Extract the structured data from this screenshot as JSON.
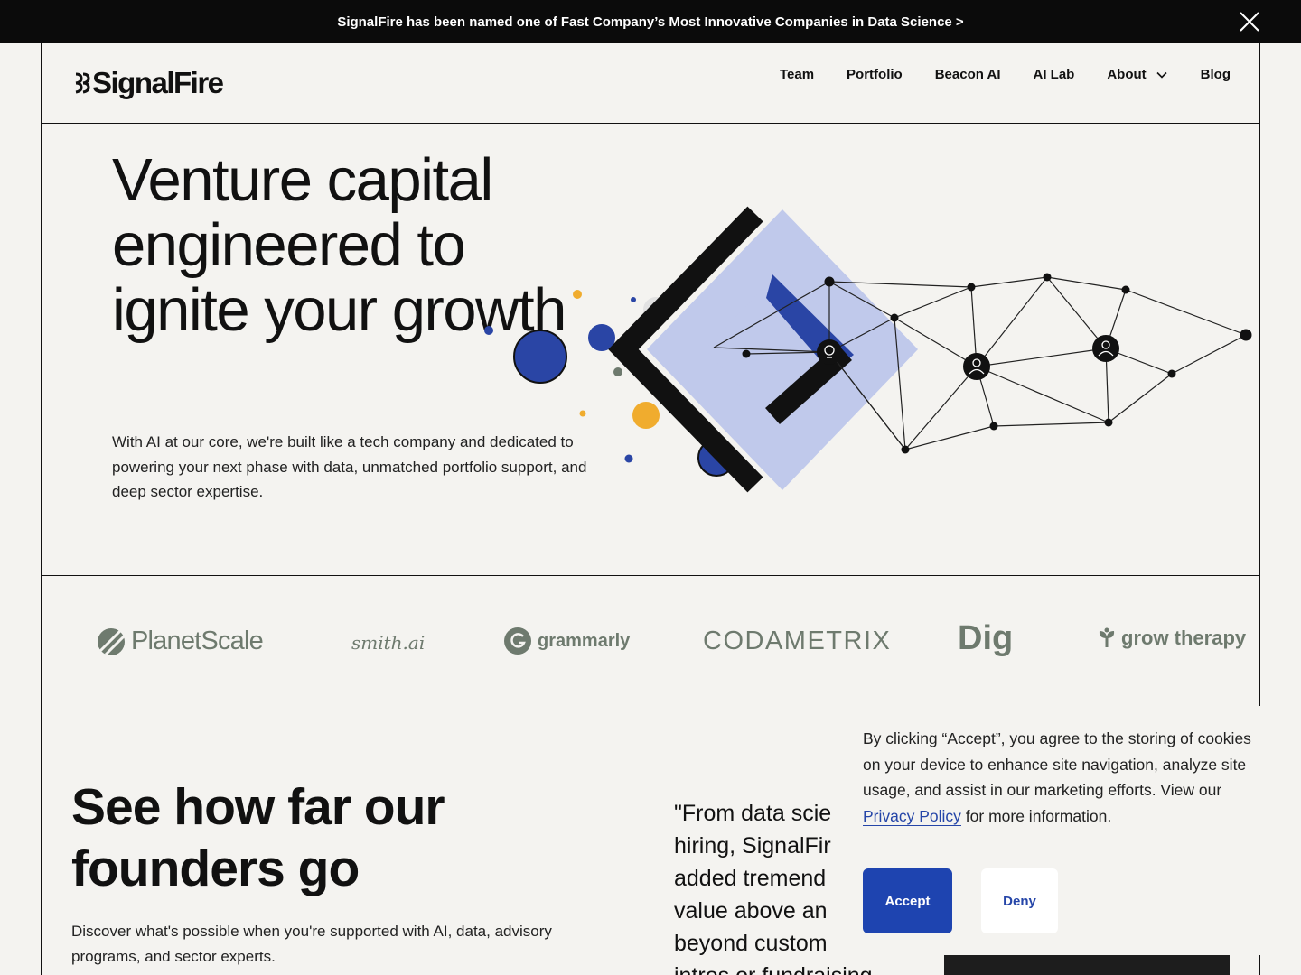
{
  "announcement": {
    "text": "SignalFire has been named one of Fast Company’s Most Innovative Companies in Data Science >",
    "close_icon": "close-icon"
  },
  "header": {
    "logo_text": "SignalFire",
    "nav": [
      {
        "label": "Team"
      },
      {
        "label": "Portfolio"
      },
      {
        "label": "Beacon AI"
      },
      {
        "label": "AI Lab"
      },
      {
        "label": "About",
        "icon": "chevron-down-icon"
      },
      {
        "label": "Blog"
      }
    ]
  },
  "hero": {
    "title": "Venture capital engineered to ignite your growth",
    "subtitle": "With AI at our core, we're built like a tech company and dedicated to powering your next phase with data, unmatched portfolio support, and deep sector expertise."
  },
  "logos": [
    {
      "name": "PlanetScale"
    },
    {
      "name": "smith.ai"
    },
    {
      "name": "grammarly"
    },
    {
      "name": "CODAMETRIX"
    },
    {
      "name": "Dig"
    },
    {
      "name": "grow therapy"
    }
  ],
  "section2": {
    "title": "See how far our founders go",
    "subtitle": "Discover what's possible when you're supported with AI, data, advisory programs, and sector experts.",
    "quote": "\"From data scie\nhiring, SignalFir\nadded tremend\nvalue above an\nbeyond custom\nintros or fundraising"
  },
  "cookie": {
    "text_before": "By clicking “Accept”, you agree to the storing of cookies on your device to enhance site navigation, analyze site usage, and assist in our marketing efforts. View our ",
    "link": "Privacy Policy",
    "text_after": " for more information.",
    "accept": "Accept",
    "deny": "Deny"
  },
  "colors": {
    "accent_blue": "#1e44b0",
    "dot_blue": "#2a45a5",
    "light_blue": "#c0c9eb",
    "orange": "#f0ac2e",
    "logo_gray": "#6e7a6e",
    "background": "#f4f3f0"
  }
}
